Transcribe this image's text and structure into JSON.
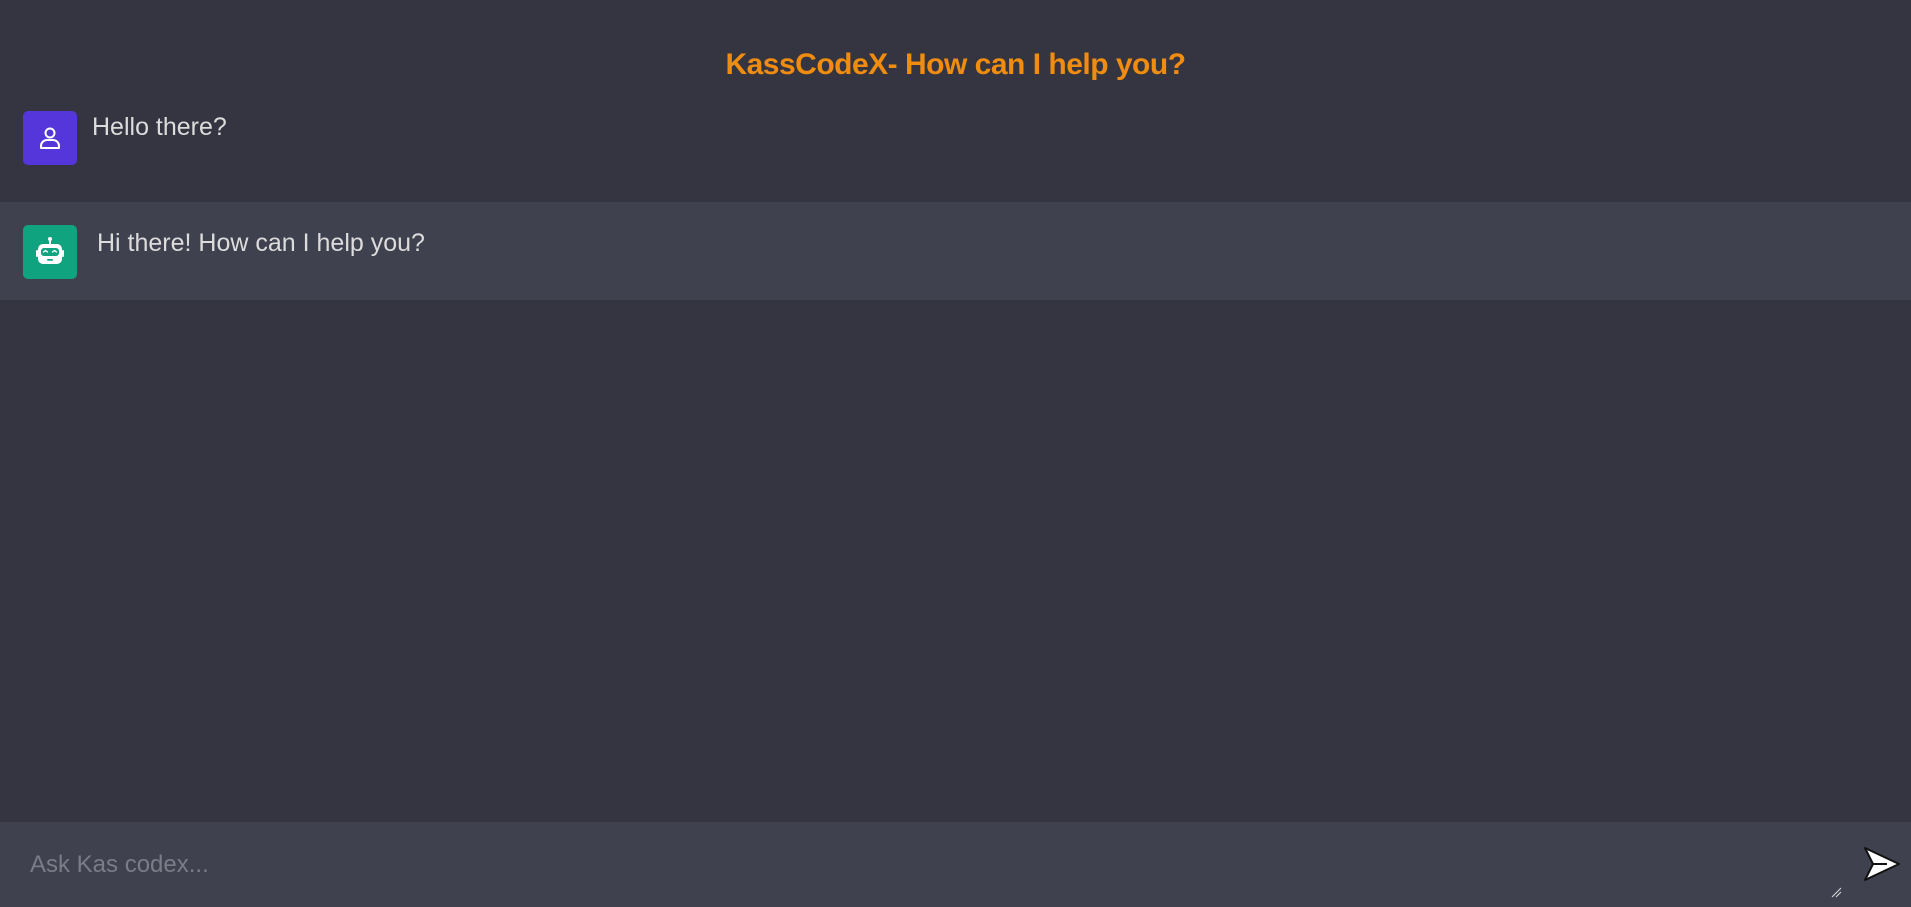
{
  "header": {
    "title": "KassCodeX- How can I help you?"
  },
  "messages": [
    {
      "role": "user",
      "avatar_icon": "user-icon",
      "text": "Hello there?"
    },
    {
      "role": "bot",
      "avatar_icon": "robot-icon",
      "text": "Hi there! How can I help you?"
    }
  ],
  "composer": {
    "placeholder": "Ask Kas codex...",
    "value": "",
    "send_icon": "send-icon"
  },
  "colors": {
    "background": "#343541",
    "bot_row": "#40414f",
    "accent_title": "#f08c0f",
    "user_avatar": "#5436da",
    "bot_avatar": "#10a37f"
  }
}
